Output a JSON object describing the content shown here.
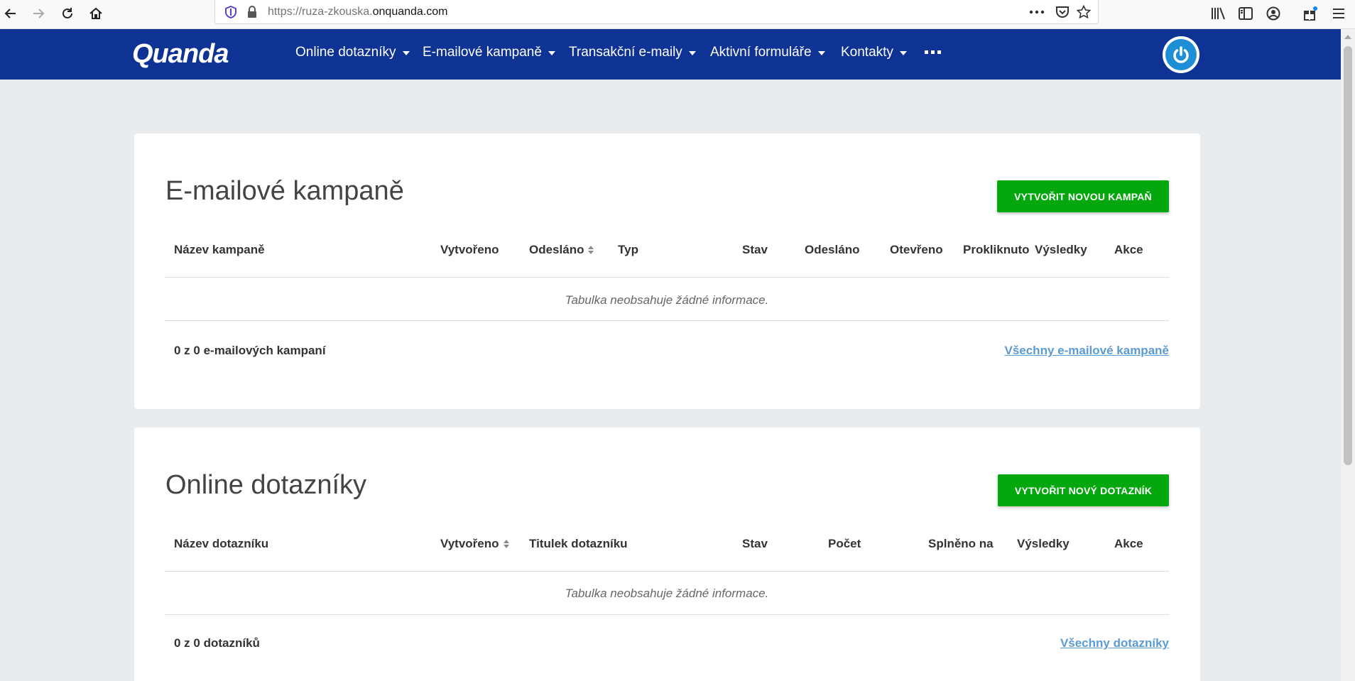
{
  "browser": {
    "url_prefix": "https://ruza-zkouska.",
    "url_host": "onquanda.com"
  },
  "nav": {
    "logo": "Quanda",
    "items": [
      "Online dotazníky",
      "E-mailové kampaně",
      "Transakční e-maily",
      "Aktivní formuláře",
      "Kontakty"
    ]
  },
  "campaigns": {
    "title": "E-mailové kampaně",
    "create_button": "VYTVOŘIT NOVOU KAMPAŇ",
    "columns": [
      "Název kampaně",
      "Vytvořeno",
      "Odesláno",
      "Typ",
      "Stav",
      "Odesláno",
      "Otevřeno",
      "Prokliknuto",
      "Výsledky",
      "Akce"
    ],
    "empty_message": "Tabulka neobsahuje žádné informace.",
    "footer_count": "0 z 0 e-mailových kampaní",
    "footer_link": "Všechny e-mailové kampaně"
  },
  "surveys": {
    "title": "Online dotazníky",
    "create_button": "VYTVOŘIT NOVÝ DOTAZNÍK",
    "columns": [
      "Název dotazníku",
      "Vytvořeno",
      "Titulek dotazníku",
      "Stav",
      "Počet",
      "Splněno na",
      "Výsledky",
      "Akce"
    ],
    "empty_message": "Tabulka neobsahuje žádné informace.",
    "footer_count": "0 z 0 dotazníků",
    "footer_link": "Všechny dotazníky"
  },
  "colors": {
    "nav_bg": "#0f3394",
    "button_green": "#05a70e",
    "link_blue": "#5b9bd5",
    "page_bg": "#e8ecef"
  }
}
